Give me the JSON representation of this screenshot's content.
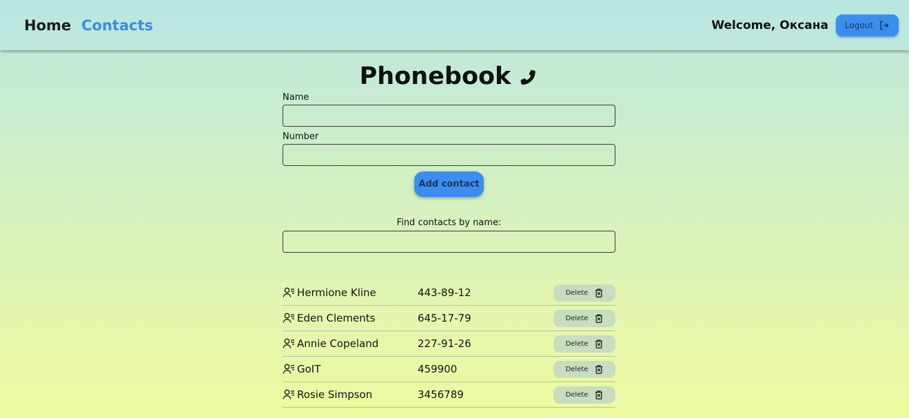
{
  "nav": {
    "home_label": "Home",
    "contacts_label": "Contacts"
  },
  "user": {
    "welcome": "Welcome, Оксана",
    "logout_label": "Logout",
    "logout_icon": "logout-icon"
  },
  "page": {
    "title": "Phonebook",
    "title_icon": "phone-icon"
  },
  "form": {
    "name_label": "Name",
    "name_value": "",
    "number_label": "Number",
    "number_value": "",
    "add_label": "Add contact"
  },
  "filter": {
    "label": "Find contacts by name:",
    "value": ""
  },
  "contacts": [
    {
      "name": "Hermione Kline",
      "number": "443-89-12",
      "delete_label": "Delete"
    },
    {
      "name": "Eden Clements",
      "number": "645-17-79",
      "delete_label": "Delete"
    },
    {
      "name": "Annie Copeland",
      "number": "227-91-26",
      "delete_label": "Delete"
    },
    {
      "name": "GoIT",
      "number": "459900",
      "delete_label": "Delete"
    },
    {
      "name": "Rosie Simpson",
      "number": "3456789",
      "delete_label": "Delete"
    }
  ],
  "colors": {
    "accent": "#3b8df0",
    "active_nav": "#3b8fd9",
    "delete_bg": "#c7ddc0"
  }
}
